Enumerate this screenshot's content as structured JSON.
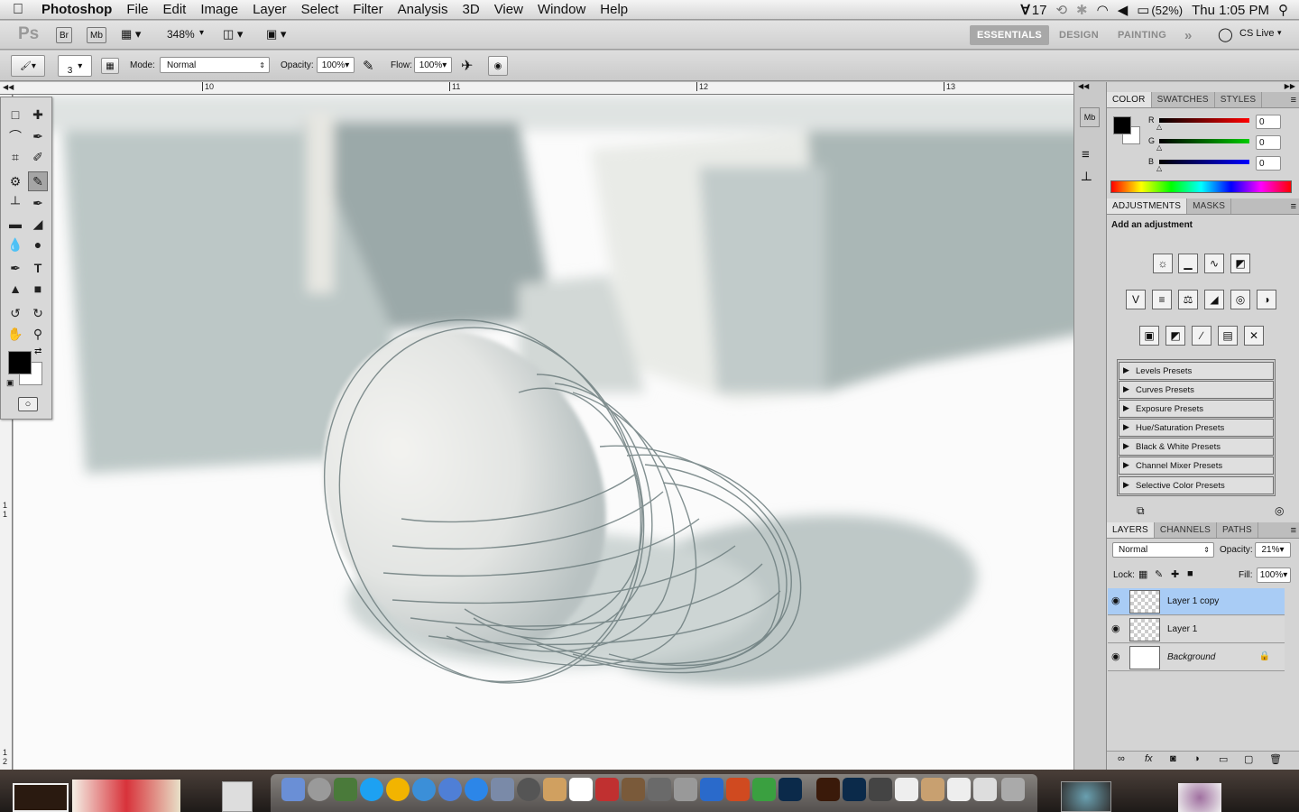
{
  "menubar": {
    "app_name": "Photoshop",
    "items": [
      "File",
      "Edit",
      "Image",
      "Layer",
      "Select",
      "Filter",
      "Analysis",
      "3D",
      "View",
      "Window",
      "Help"
    ],
    "status": {
      "adobe_count": "17",
      "battery": "(52%)",
      "clock": "Thu 1:05 PM"
    }
  },
  "appbar": {
    "ps_logo": "Ps",
    "bridge": "Br",
    "minibridge": "Mb",
    "zoom": "348%",
    "workspaces": [
      "ESSENTIALS",
      "DESIGN",
      "PAINTING"
    ],
    "more": "»",
    "cs_live": "CS Live"
  },
  "options": {
    "brush_size": "3",
    "mode_label": "Mode:",
    "mode_value": "Normal",
    "opacity_label": "Opacity:",
    "opacity_value": "100%",
    "flow_label": "Flow:",
    "flow_value": "100%"
  },
  "ruler": {
    "top_labels": [
      "10",
      "11",
      "12",
      "13"
    ],
    "left_labels": [
      "1",
      "1",
      "1",
      "2"
    ]
  },
  "color_panel": {
    "tabs": [
      "COLOR",
      "SWATCHES",
      "STYLES"
    ],
    "channels": [
      {
        "label": "R",
        "value": "0",
        "color": "#d00000"
      },
      {
        "label": "G",
        "value": "0",
        "color": "#00a000"
      },
      {
        "label": "B",
        "value": "0",
        "color": "#0000d0"
      }
    ]
  },
  "adjustments_panel": {
    "tabs": [
      "ADJUSTMENTS",
      "MASKS"
    ],
    "heading": "Add an adjustment",
    "presets": [
      "Levels Presets",
      "Curves Presets",
      "Exposure Presets",
      "Hue/Saturation Presets",
      "Black & White Presets",
      "Channel Mixer Presets",
      "Selective Color Presets"
    ]
  },
  "layers_panel": {
    "tabs": [
      "LAYERS",
      "CHANNELS",
      "PATHS"
    ],
    "blend_mode": "Normal",
    "opacity_label": "Opacity:",
    "opacity_value": "21%",
    "lock_label": "Lock:",
    "fill_label": "Fill:",
    "fill_value": "100%",
    "layers": [
      {
        "name": "Layer 1 copy",
        "selected": true
      },
      {
        "name": "Layer 1",
        "selected": false
      },
      {
        "name": "Background",
        "selected": false
      }
    ]
  }
}
